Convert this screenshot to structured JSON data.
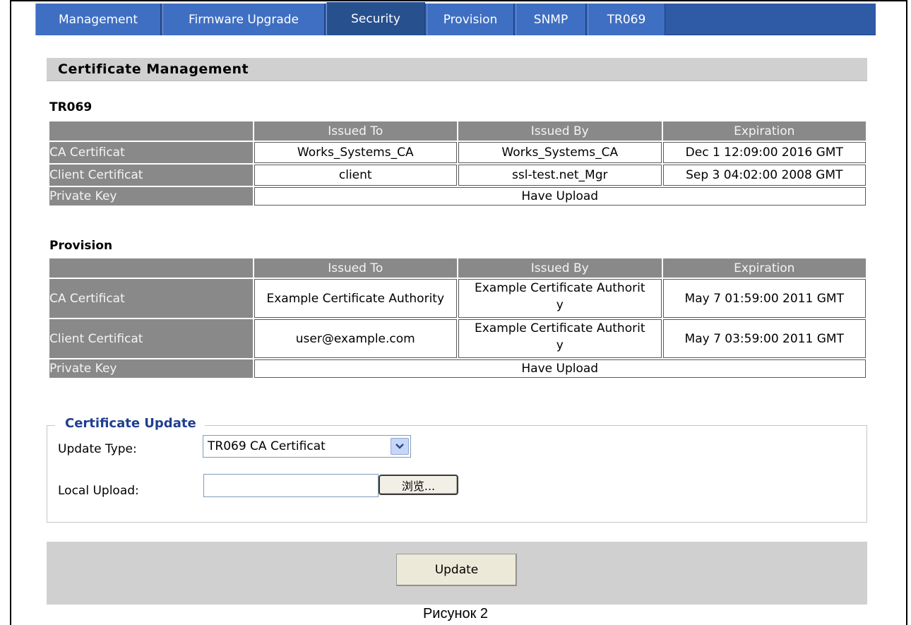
{
  "tabs": [
    {
      "label": "Management"
    },
    {
      "label": "Firmware Upgrade"
    },
    {
      "label": "Security"
    },
    {
      "label": "Provision"
    },
    {
      "label": "SNMP"
    },
    {
      "label": "TR069"
    }
  ],
  "page_title": "Certificate Management",
  "tr069": {
    "title": "TR069",
    "columns": [
      "",
      "Issued To",
      "Issued By",
      "Expiration"
    ],
    "rows": [
      {
        "name": "CA Certificat",
        "issued_to": "Works_Systems_CA",
        "issued_by": "Works_Systems_CA",
        "expiration": "Dec 1 12:09:00 2016 GMT"
      },
      {
        "name": "Client Certificat",
        "issued_to": "client",
        "issued_by": "ssl-test.net_Mgr",
        "expiration": "Sep 3 04:02:00 2008 GMT"
      }
    ],
    "private_key": {
      "name": "Private Key",
      "status": "Have Upload"
    }
  },
  "provision": {
    "title": "Provision",
    "columns": [
      "",
      "Issued To",
      "Issued By",
      "Expiration"
    ],
    "rows": [
      {
        "name": "CA Certificat",
        "issued_to": "Example Certificate Authority",
        "issued_by_line1": "Example Certificate Authorit",
        "issued_by_line2": "y",
        "expiration": "May 7 01:59:00 2011 GMT"
      },
      {
        "name": "Client Certificat",
        "issued_to": "user@example.com",
        "issued_by_line1": "Example Certificate Authorit",
        "issued_by_line2": "y",
        "expiration": "May 7 03:59:00 2011 GMT"
      }
    ],
    "private_key": {
      "name": "Private Key",
      "status": "Have Upload"
    }
  },
  "update": {
    "legend": "Certificate Update",
    "type_label": "Update Type:",
    "type_value": "TR069 CA Certificat",
    "upload_label": "Local Upload:",
    "upload_value": "",
    "browse_label": "浏览...",
    "submit_label": "Update"
  },
  "caption": "Рисунок 2"
}
